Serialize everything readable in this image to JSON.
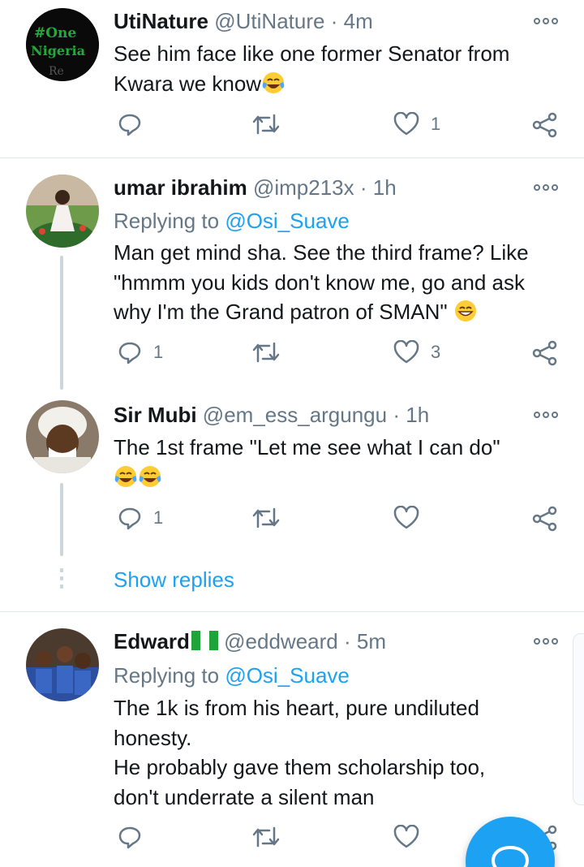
{
  "tweets": [
    {
      "name": "UtiNature",
      "handle": "@UtiNature",
      "time": "4m",
      "avatar_text_1": "#One",
      "avatar_text_2": "Nigeria",
      "body": [
        "See him face like one former Senator from",
        "Kwara we know"
      ],
      "emoji": [
        "face-with-tears-of-joy"
      ],
      "replies": "",
      "retweets": "",
      "likes": "1"
    },
    {
      "name": "umar ibrahim",
      "handle": "@imp213x",
      "time": "1h",
      "replying_label": "Replying to",
      "replying_handle": "@Osi_Suave",
      "body": [
        "Man get mind sha. See the third frame? Like",
        "\"hmmm you kids don't know me, go and ask",
        "why I'm the Grand patron of SMAN\""
      ],
      "emoji": [
        "grinning-face-with-smiling-eyes"
      ],
      "replies": "1",
      "retweets": "",
      "likes": "3"
    },
    {
      "name": "Sir Mubi",
      "handle": "@em_ess_argungu",
      "time": "1h",
      "body": [
        "The 1st frame \"Let me see what I can do\""
      ],
      "emoji": [
        "face-with-tears-of-joy",
        "face-with-tears-of-joy"
      ],
      "replies": "1",
      "retweets": "",
      "likes": ""
    },
    {
      "name": "Edward",
      "handle": "@eddweard",
      "time": "5m",
      "flag": "nigeria-flag",
      "replying_label": "Replying to",
      "replying_handle": "@Osi_Suave",
      "body": [
        "The 1k  is from his heart, pure undiluted",
        "honesty.",
        "He probably gave them scholarship too,",
        "don't underrate a silent man"
      ],
      "replies": "",
      "retweets": "",
      "likes": ""
    }
  ],
  "show_replies": "Show replies",
  "separator": "·",
  "icons": {
    "reply": "reply-icon",
    "retweet": "retweet-icon",
    "like": "heart-icon",
    "share": "share-icon",
    "more": "more-options-icon",
    "compose": "compose-icon"
  },
  "colors": {
    "accent": "#1da1f2",
    "muted": "#657786",
    "text": "#14171a",
    "divider": "#e1e8ed"
  }
}
